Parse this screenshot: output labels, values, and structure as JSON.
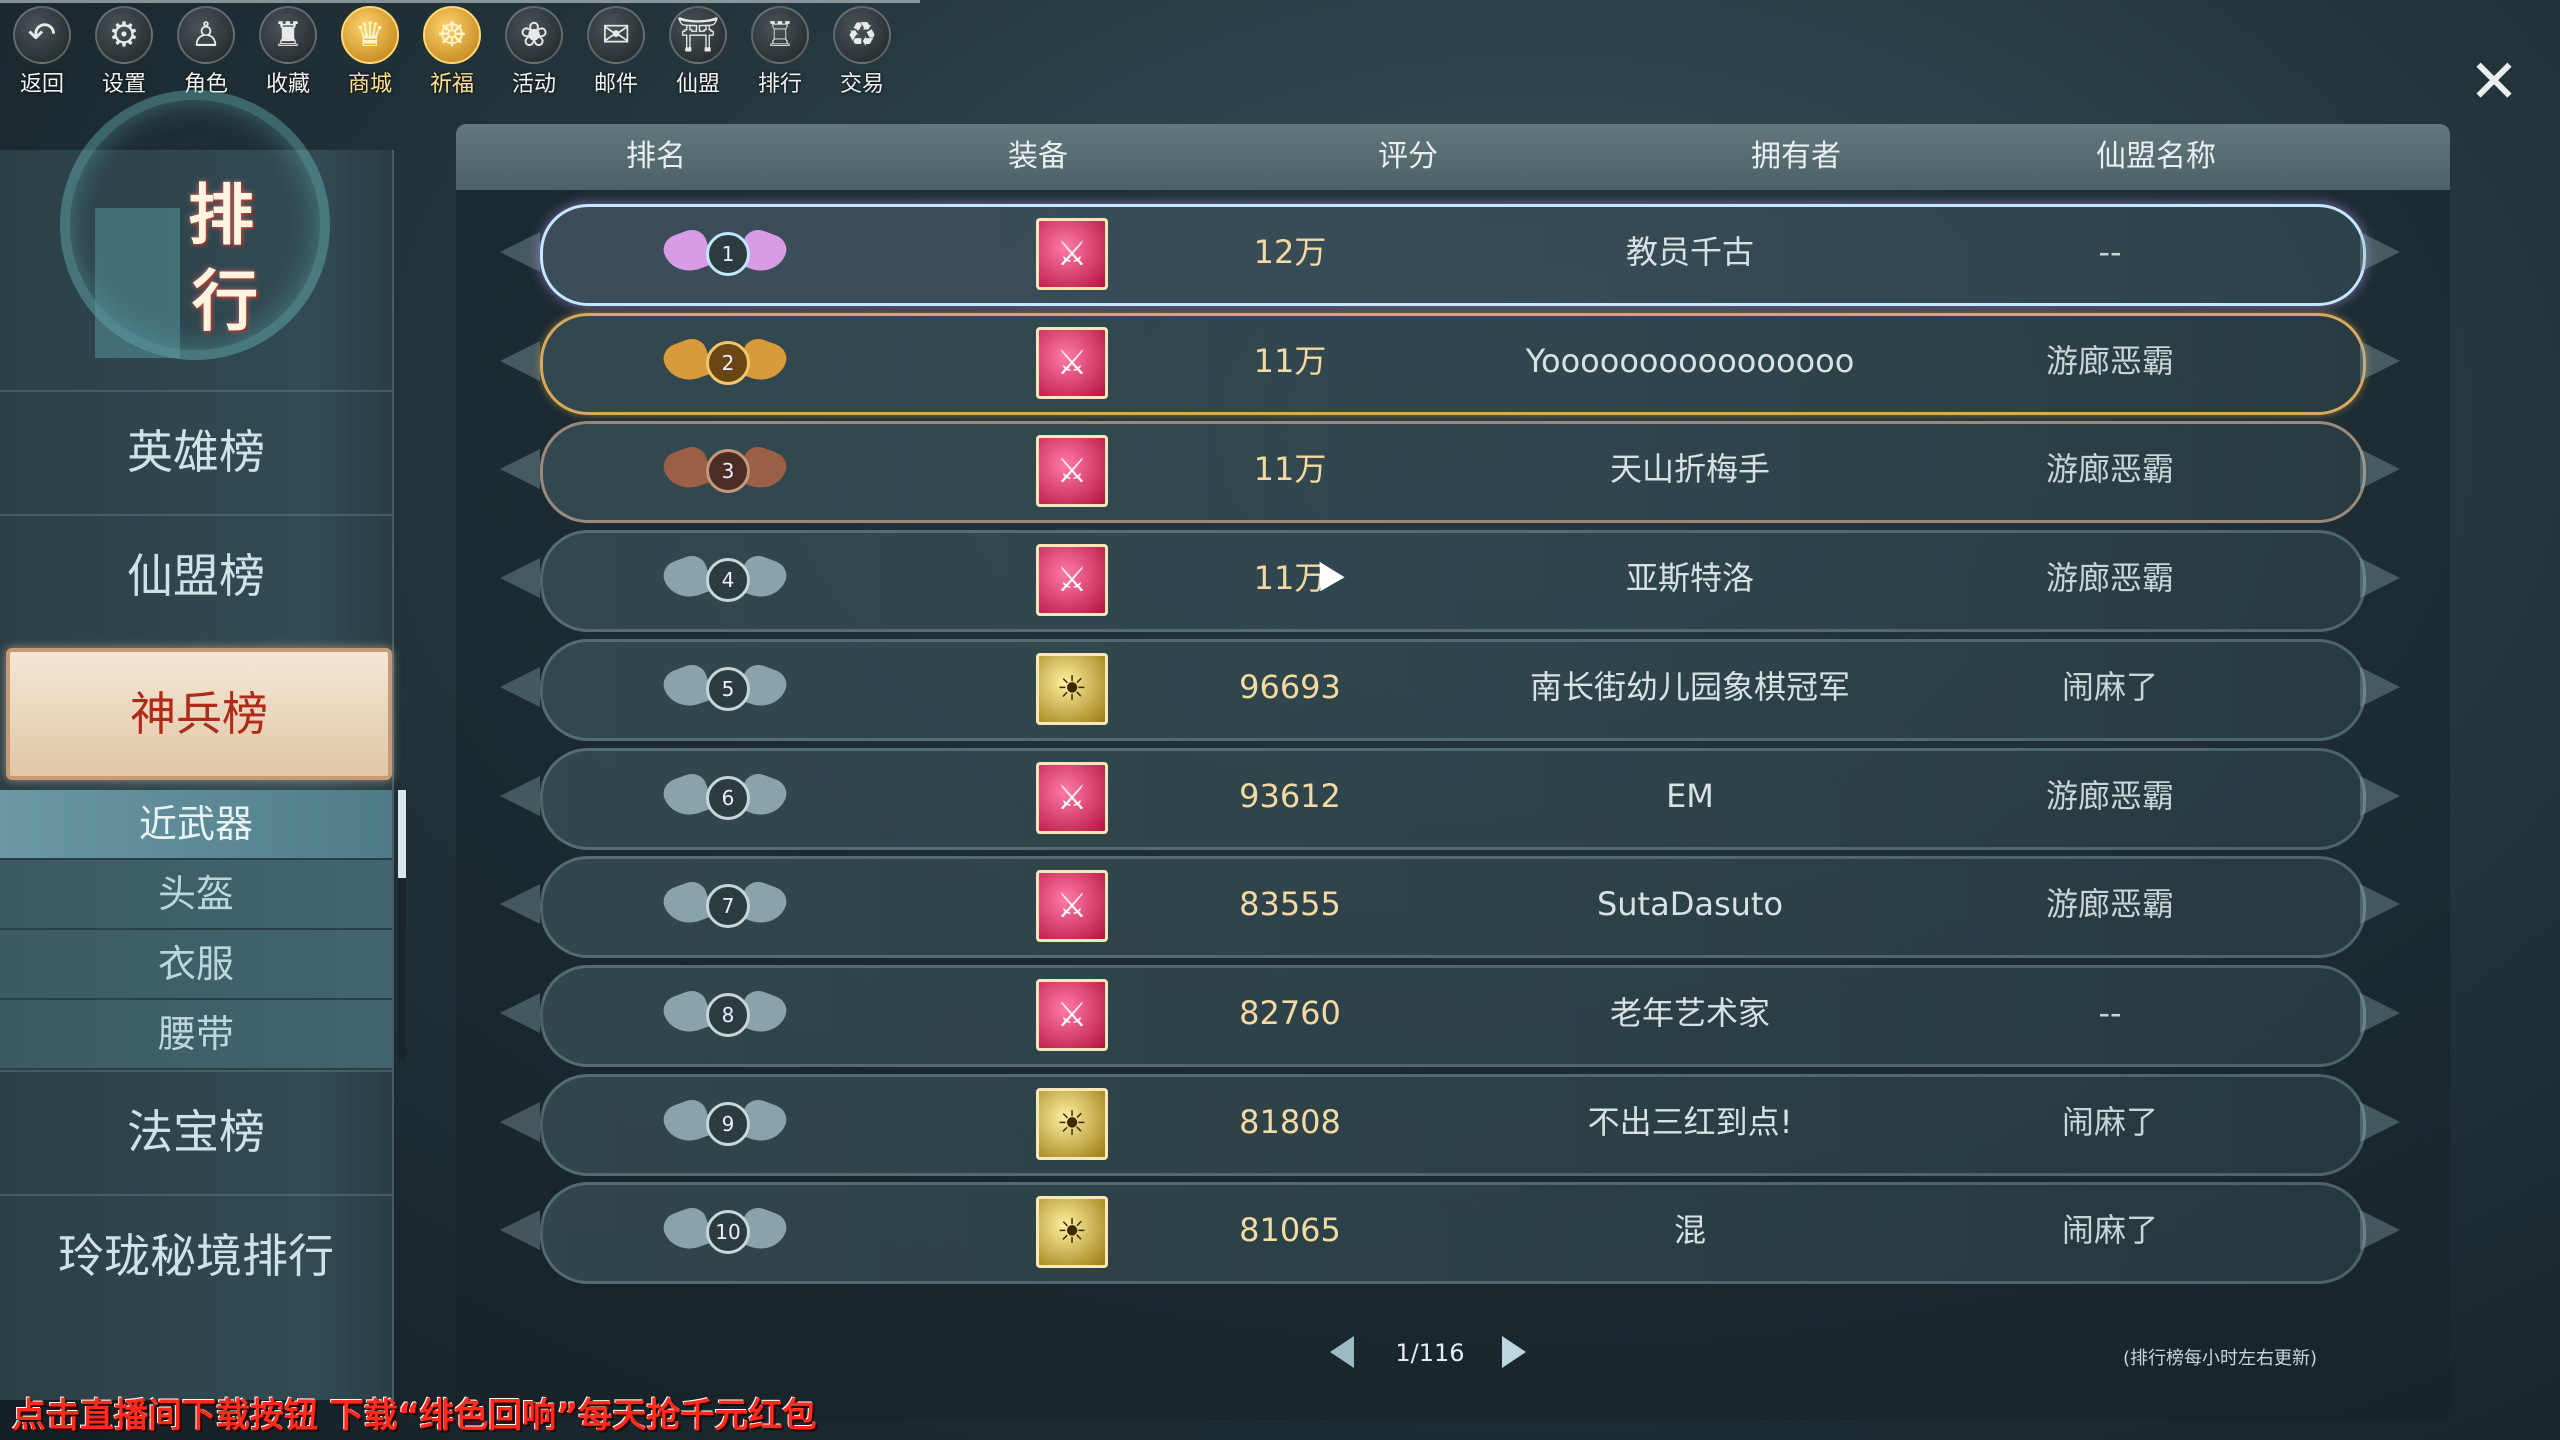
{
  "toolbar": {
    "items": [
      {
        "label": "返回",
        "icon": "back-arrow-icon",
        "glyph": "↶"
      },
      {
        "label": "设置",
        "icon": "gear-icon",
        "glyph": "⚙"
      },
      {
        "label": "角色",
        "icon": "character-icon",
        "glyph": "♙"
      },
      {
        "label": "收藏",
        "icon": "collection-icon",
        "glyph": "♜"
      },
      {
        "label": "商城",
        "icon": "shop-icon",
        "glyph": "♛"
      },
      {
        "label": "祈福",
        "icon": "blessing-icon",
        "glyph": "☸"
      },
      {
        "label": "活动",
        "icon": "activity-fan-icon",
        "glyph": "❀"
      },
      {
        "label": "邮件",
        "icon": "mail-crane-icon",
        "glyph": "✉"
      },
      {
        "label": "仙盟",
        "icon": "guild-pavilion-icon",
        "glyph": "⛩"
      },
      {
        "label": "排行",
        "icon": "ranking-icon",
        "glyph": "♖"
      },
      {
        "label": "交易",
        "icon": "trade-icon",
        "glyph": "♻"
      }
    ],
    "close_glyph": "✕"
  },
  "sidebar": {
    "title_chars": [
      "排",
      "行"
    ],
    "menu": {
      "hero": "英雄榜",
      "guild": "仙盟榜",
      "weapon": "神兵榜",
      "treasure": "法宝榜",
      "realm": "玲珑秘境排行"
    },
    "sub": {
      "melee": "近武器",
      "helmet": "头盔",
      "clothes": "衣服",
      "belt": "腰带"
    }
  },
  "table": {
    "headers": {
      "rank": "排名",
      "equip": "装备",
      "score": "评分",
      "owner": "拥有者",
      "guild": "仙盟名称"
    },
    "rows": [
      {
        "rank": "1",
        "equip": "red",
        "equip_glyph": "⚔",
        "score": "12万",
        "owner": "教员千古",
        "guild": "--"
      },
      {
        "rank": "2",
        "equip": "red",
        "equip_glyph": "⚔",
        "score": "11万",
        "owner": "Yoooooooooooooooo",
        "guild": "游廊恶霸"
      },
      {
        "rank": "3",
        "equip": "red",
        "equip_glyph": "⚔",
        "score": "11万",
        "owner": "天山折梅手",
        "guild": "游廊恶霸"
      },
      {
        "rank": "4",
        "equip": "red",
        "equip_glyph": "⚔",
        "score": "11万",
        "owner": "亚斯特洛",
        "guild": "游廊恶霸"
      },
      {
        "rank": "5",
        "equip": "gold",
        "equip_glyph": "☀",
        "score": "96693",
        "owner": "南长街幼儿园象棋冠军",
        "guild": "闹麻了"
      },
      {
        "rank": "6",
        "equip": "red",
        "equip_glyph": "⚔",
        "score": "93612",
        "owner": "EM",
        "guild": "游廊恶霸"
      },
      {
        "rank": "7",
        "equip": "red",
        "equip_glyph": "⚔",
        "score": "83555",
        "owner": "SutaDasuto",
        "guild": "游廊恶霸"
      },
      {
        "rank": "8",
        "equip": "red",
        "equip_glyph": "⚔",
        "score": "82760",
        "owner": "老年艺术家",
        "guild": "--"
      },
      {
        "rank": "9",
        "equip": "gold",
        "equip_glyph": "☀",
        "score": "81808",
        "owner": "不出三红到点!",
        "guild": "闹麻了"
      },
      {
        "rank": "10",
        "equip": "gold",
        "equip_glyph": "☀",
        "score": "81065",
        "owner": "混",
        "guild": "闹麻了"
      }
    ]
  },
  "pagination": {
    "page": "1/116",
    "note": "(排行榜每小时左右更新)"
  },
  "promo_text": "点击直播间下载按钮 下载“绯色回响”每天抢千元红包"
}
